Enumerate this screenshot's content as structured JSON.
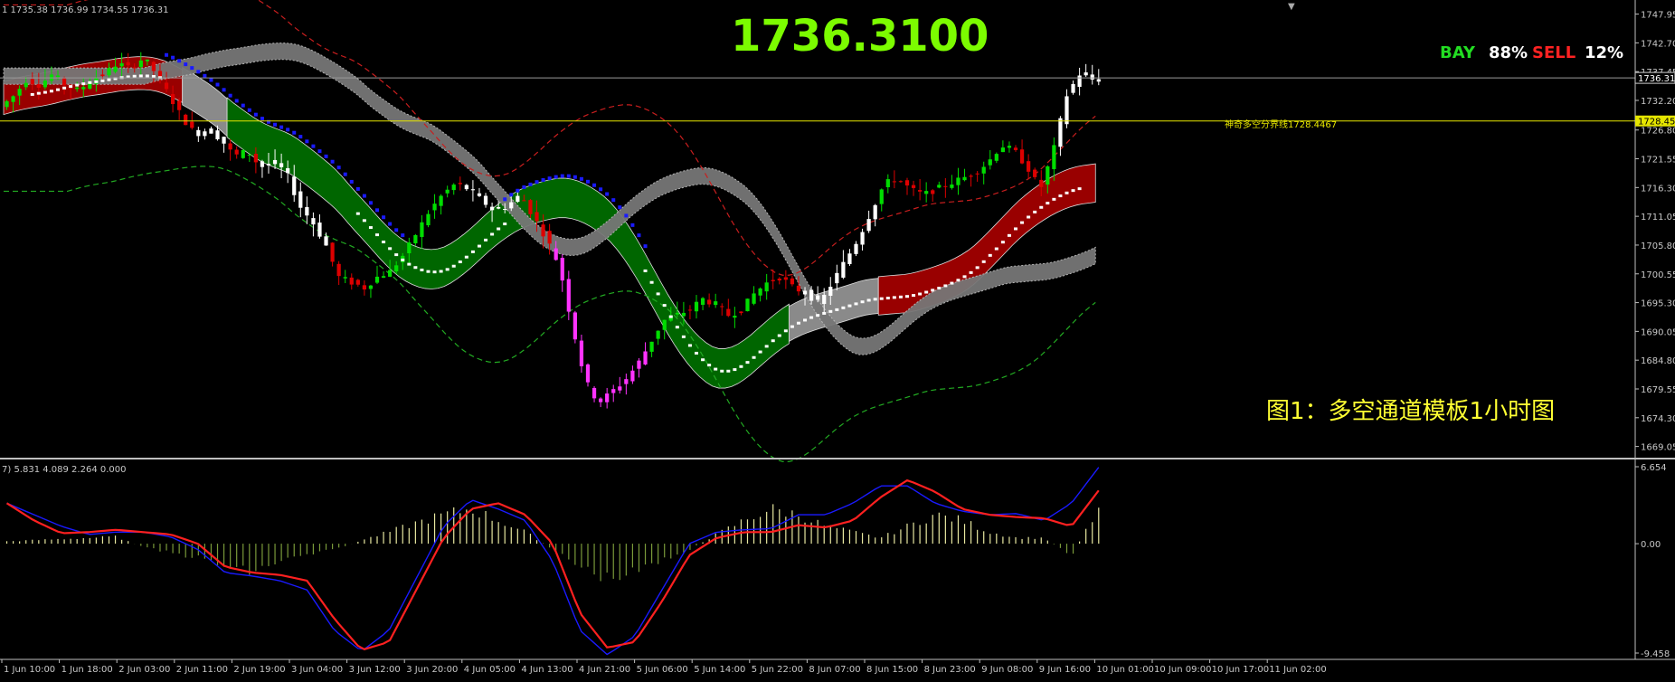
{
  "ohlc_header": "1 1735.38 1736.99 1734.55 1736.31",
  "big_price": "1736.3100",
  "signal": {
    "bay_label": "BAY",
    "bay_value": "88%",
    "sell_label": "SELL",
    "sell_value": "12%",
    "bay_color": "#22dd22",
    "sell_color": "#ff2222"
  },
  "boundary_label": "神奇多空分界线1728.4467",
  "caption": "图1：多空通道模板1小时图",
  "current_price_tag": "1736.31",
  "boundary_price_tag": "1728.45",
  "colors": {
    "up_candle": "#00dd00",
    "down_candle": "#dd0000",
    "white_candle": "#ffffff",
    "blue_dots": "#1a1aff",
    "magenta": "#ff33ff",
    "green_band": "#006600",
    "red_band": "#990000",
    "gray_band": "#8a8a8a",
    "macd_red": "#ff2020",
    "macd_blue": "#1a1aff",
    "hist_up": "#e8e8a0",
    "hist_down": "#7a9a3a"
  },
  "chart_data": [
    {
      "type": "candlestick",
      "title": "",
      "y_ticks": [
        "1747.95",
        "1742.70",
        "1737.45",
        "1732.20",
        "1726.80",
        "1721.55",
        "1716.30",
        "1711.05",
        "1705.80",
        "1700.55",
        "1695.30",
        "1690.05",
        "1684.80",
        "1679.55",
        "1674.30",
        "1669.05"
      ],
      "ylim": [
        1667.5,
        1749.2
      ],
      "x_ticks": [
        "1 Jun 10:00",
        "1 Jun 18:00",
        "2 Jun 03:00",
        "2 Jun 11:00",
        "2 Jun 19:00",
        "3 Jun 04:00",
        "3 Jun 12:00",
        "3 Jun 20:00",
        "4 Jun 05:00",
        "4 Jun 13:00",
        "4 Jun 21:00",
        "5 Jun 06:00",
        "5 Jun 14:00",
        "5 Jun 22:00",
        "8 Jun 07:00",
        "8 Jun 15:00",
        "8 Jun 23:00",
        "9 Jun 08:00",
        "9 Jun 16:00",
        "10 Jun 01:00",
        "10 Jun 09:00",
        "10 Jun 17:00",
        "11 Jun 02:00"
      ],
      "price_path": [
        1731,
        1733,
        1736,
        1735,
        1737,
        1735,
        1734,
        1736,
        1737,
        1739,
        1738,
        1740,
        1737,
        1733,
        1729,
        1726,
        1727,
        1725,
        1722,
        1723,
        1720,
        1721,
        1719,
        1713,
        1710,
        1706,
        1700,
        1699,
        1698,
        1700,
        1701,
        1704,
        1708,
        1712,
        1715,
        1717,
        1716,
        1714,
        1712,
        1713,
        1715,
        1711,
        1707,
        1702,
        1691,
        1681,
        1677,
        1679,
        1681,
        1684,
        1688,
        1692,
        1693,
        1694,
        1696,
        1695,
        1693,
        1694,
        1697,
        1699,
        1700,
        1698,
        1697,
        1695,
        1699,
        1703,
        1707,
        1712,
        1717,
        1718,
        1716,
        1715,
        1716,
        1717,
        1718,
        1719,
        1721,
        1724,
        1723,
        1720,
        1716,
        1723,
        1733,
        1737,
        1736
      ],
      "levels": {
        "current": 1736.31,
        "boundary": 1728.4467
      }
    },
    {
      "type": "line",
      "title": "",
      "header": "7) 5.831 4.089 2.264 0.000",
      "y_ticks": [
        "6.654",
        "0.00",
        "-9.458"
      ],
      "ylim": [
        -9.458,
        6.654
      ],
      "series": [
        {
          "values": [
            3.5,
            2,
            0.9,
            1,
            1.2,
            1,
            0.8,
            0,
            -2,
            -2.5,
            -2.7,
            -3.2,
            -6.5,
            -9.2,
            -8.5,
            -4,
            0.5,
            3,
            3.5,
            2.5,
            0,
            -6,
            -9,
            -8.5,
            -5,
            -1,
            0.5,
            1,
            1,
            1.6,
            1.4,
            2,
            4,
            5.5,
            4.5,
            3,
            2.5,
            2.3,
            2.2,
            1.5,
            4.6
          ]
        },
        {
          "values": [
            3.5,
            2.5,
            1.5,
            0.8,
            1,
            1,
            0.6,
            -0.5,
            -2.5,
            -2.8,
            -3.2,
            -4,
            -7.5,
            -9.3,
            -7.5,
            -3,
            1.5,
            3.8,
            3,
            2,
            -1.5,
            -7.5,
            -9.6,
            -8,
            -4,
            0,
            1,
            1.2,
            1.3,
            2.5,
            2.5,
            3.5,
            5,
            5,
            3.5,
            2.8,
            2.5,
            2.6,
            2,
            3.5,
            6.6
          ]
        },
        {
          "values": [
            0.2,
            0.3,
            0.4,
            0.5,
            0.6,
            -0.3,
            -0.8,
            -1.2,
            -2,
            -2.5,
            -1.5,
            -1,
            -0.5,
            0.3,
            1,
            1.8,
            2.5,
            3,
            2,
            1,
            -0.5,
            -2,
            -3,
            -2.5,
            -1.5,
            -0.5,
            0.8,
            2,
            3,
            2.5,
            1.5,
            1,
            0.5,
            1.5,
            2.5,
            2,
            1,
            0.5,
            0.5,
            -1,
            3
          ]
        }
      ]
    }
  ]
}
